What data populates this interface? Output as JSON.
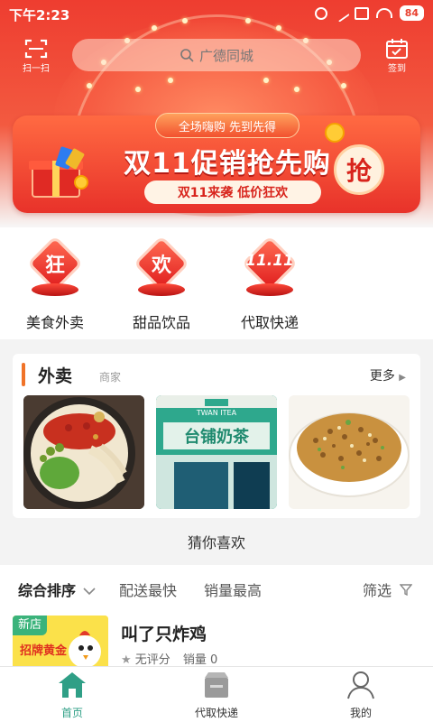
{
  "status": {
    "time": "下午2:23",
    "battery": "84"
  },
  "header": {
    "scan_label": "扫一扫",
    "search_placeholder": "广德同城",
    "signin_label": "签到"
  },
  "promo": {
    "top_text": "全场嗨购 先到先得",
    "title": "双11促销抢先购",
    "subtitle": "双11来袭 低价狂欢",
    "grab": "抢"
  },
  "categories": [
    {
      "glyph": "狂",
      "label": "美食外卖"
    },
    {
      "glyph": "欢",
      "label": "甜品饮品"
    },
    {
      "glyph": "11.11",
      "label": "代取快递"
    }
  ],
  "takeout": {
    "title": "外卖",
    "subtitle": "商家",
    "more": "更多",
    "shop_sign": "台铺奶茶",
    "shop_sign_en": "TWAN ITEA"
  },
  "guess": "猜你喜欢",
  "sort": {
    "items": [
      "综合排序",
      "配送最快",
      "销量最高"
    ],
    "filter": "筛选"
  },
  "store": {
    "badge": "新店",
    "sign": "招牌黄金",
    "name": "叫了只炸鸡",
    "rating": "无评分",
    "sales": "销量 0"
  },
  "tabbar": {
    "items": [
      "首页",
      "代取快递",
      "我的"
    ]
  },
  "colors": {
    "primary_red": "#ee3d30",
    "accent_green": "#2f9f86",
    "new_badge": "#3bb37b"
  }
}
